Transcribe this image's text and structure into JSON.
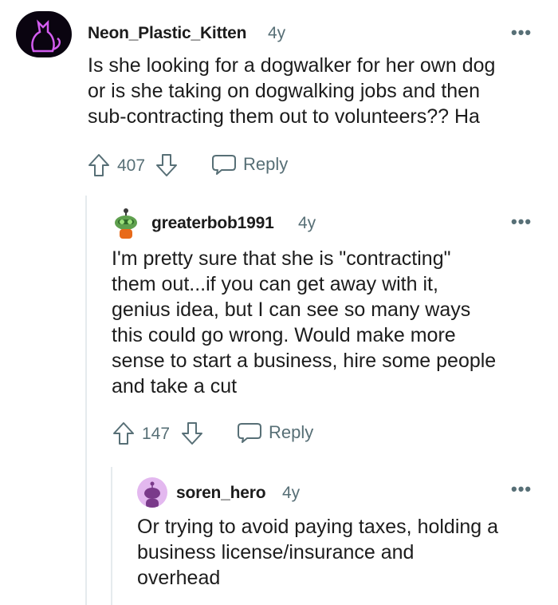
{
  "comments": [
    {
      "username": "Neon_Plastic_Kitten",
      "age": "4y",
      "lines": [
        "Is she looking for a dogwalker for her own dog",
        "or is she taking on dogwalking jobs and then",
        "sub-contracting them out to volunteers?? Ha"
      ],
      "score": "407",
      "reply_label": "Reply",
      "more": "•••"
    },
    {
      "username": "greaterbob1991",
      "age": "4y",
      "lines": [
        "I'm pretty sure that she is \"contracting\"",
        "them out...if you can get away with it,",
        "genius idea, but I can see so many ways",
        "this could go wrong. Would make more",
        "sense to start a business, hire some people",
        "and take a cut"
      ],
      "score": "147",
      "reply_label": "Reply",
      "more": "•••"
    },
    {
      "username": "soren_hero",
      "age": "4y",
      "lines": [
        "Or trying to avoid paying taxes, holding a",
        "business license/insurance and",
        "overhead"
      ],
      "more": "•••"
    }
  ],
  "icons": {
    "upvote": "upvote-arrow-icon",
    "downvote": "downvote-arrow-icon",
    "reply": "speech-bubble-icon"
  },
  "colors": {
    "accent_neon": "#c040e0",
    "muted": "#576f76"
  }
}
